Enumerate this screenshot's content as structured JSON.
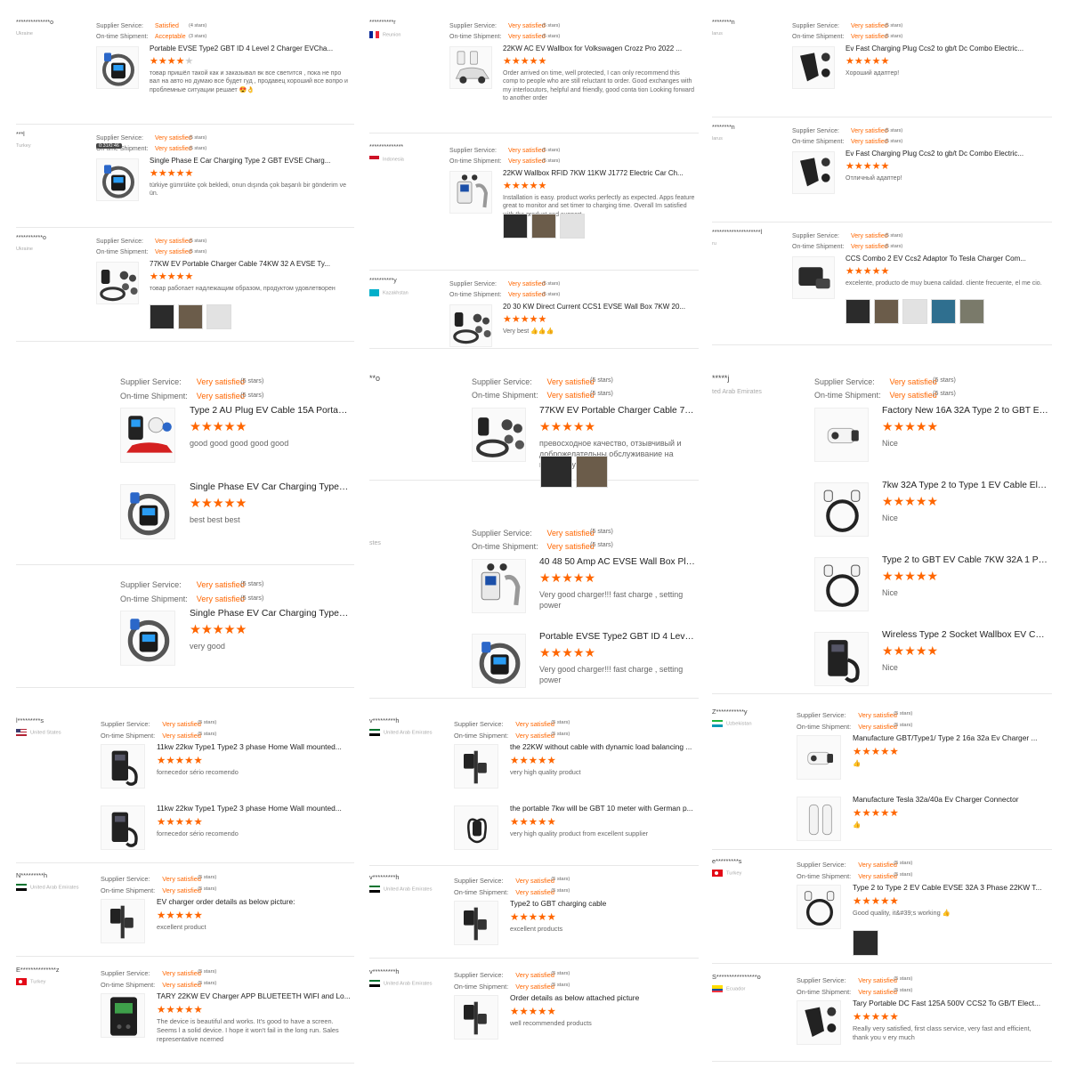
{
  "status_label": "Very satisfied",
  "stars_suffix": "(5 stars)",
  "supplier_label": "Supplier Service:",
  "shipment_label": "On-time Shipment:",
  "tiles": [
    {
      "id": "t1",
      "reviews": [
        {
          "user": "**************o",
          "country": "Ukraine",
          "flag": "none",
          "supplier_value": "Satisfied",
          "supplier_stars": "(4 stars)",
          "shipment_value": "Acceptable",
          "shipment_stars": "(3 stars)",
          "products": [
            {
              "title": "Portable EVSE Type2 GBT ID 4 Level 2 Charger EVCha...",
              "rating": 4,
              "img": "portable",
              "comment": "товар пришёл такой как и заказывал вк все светится , пока не про вал на авто но думаю все будет гуд , продавец хороший все вопро и проблемные ситуации решает 😍👌"
            }
          ],
          "thumbs": 0
        },
        {
          "user": "***l",
          "country": "Turkey",
          "flag": "none",
          "overlay_tag": "0:31/0:46",
          "supplier_value": "Very satisfied",
          "supplier_stars": "(5 stars)",
          "shipment_value": "Very satisfied",
          "shipment_stars": "(5 stars)",
          "products": [
            {
              "title": "Single Phase E Car Charging Type 2 GBT EVSE Charg...",
              "rating": 5,
              "img": "coil",
              "comment": "türkiye gümrükte çok bekledi, onun dışında çok başarılı bir gönderim ve ün."
            }
          ],
          "thumbs": 0
        },
        {
          "user": "***********o",
          "country": "Ukraine",
          "flag": "none",
          "supplier_value": "Very satisfied",
          "supplier_stars": "(5 stars)",
          "shipment_value": "Very satisfied",
          "shipment_stars": "(5 stars)",
          "products": [
            {
              "title": "77KW EV Portable Charger Cable 74KW 32 A EVSE Ty...",
              "rating": 5,
              "img": "kit",
              "comment": "товар работает надлежащим образом, продуктом удовлетворен"
            }
          ],
          "thumbs": 3
        }
      ]
    },
    {
      "id": "t2",
      "reviews": [
        {
          "user": "**********r",
          "country": "Reunion",
          "flag": "fr",
          "supplier_value": "Very satisfied",
          "supplier_stars": "(5 stars)",
          "shipment_value": "Very satisfied",
          "shipment_stars": "(5 stars)",
          "products": [
            {
              "title": "22KW AC EV Wallbox for Volkswagen Crozz Pro 2022 ...",
              "rating": 5,
              "img": "car",
              "comment": "Order arrived on time, well protected, I can only recommend this comp to people who are still reluctant to order. Good exchanges with my interlocutors, helpful and friendly, good conta tion Looking forward to another order"
            }
          ],
          "thumbs": 0
        },
        {
          "user": "**************",
          "country": "Indonesia",
          "flag": "id",
          "supplier_value": "Very satisfied",
          "supplier_stars": "(5 stars)",
          "shipment_value": "Very satisfied",
          "shipment_stars": "(5 stars)",
          "products": [
            {
              "title": "22KW Wallbox RFID 7KW 11KW J1772 Electric Car Ch...",
              "rating": 5,
              "img": "wallbox",
              "comment": "Installation is easy. product works perfectly as expected. Apps feature great to monitor and set timer to charging time. Overall Im satisfied with the product and support"
            }
          ],
          "thumbs": 3
        },
        {
          "user": "**********y",
          "country": "Kazakhstan",
          "flag": "kz",
          "supplier_value": "Very satisfied",
          "supplier_stars": "(5 stars)",
          "shipment_value": "Very satisfied",
          "shipment_stars": "(5 stars)",
          "products": [
            {
              "title": "20 30 KW Direct Current CCS1 EVSE Wall Box 7KW 20...",
              "rating": 5,
              "img": "kit",
              "comment": "Very best 👍👍👍"
            }
          ],
          "thumbs": 0
        }
      ]
    },
    {
      "id": "t3",
      "reviews": [
        {
          "user": "********n",
          "country": "larus",
          "flag": "none",
          "supplier_value": "Very satisfied",
          "supplier_stars": "(5 stars)",
          "shipment_value": "Very satisfied",
          "shipment_stars": "(5 stars)",
          "products": [
            {
              "title": "Ev Fast Charging Plug Ccs2 to gb/t Dc Combo Electric...",
              "rating": 5,
              "img": "plug",
              "comment": "Хороший адаптер!"
            }
          ],
          "thumbs": 0
        },
        {
          "user": "********n",
          "country": "larus",
          "flag": "none",
          "supplier_value": "Very satisfied",
          "supplier_stars": "(5 stars)",
          "shipment_value": "Very satisfied",
          "shipment_stars": "(5 stars)",
          "products": [
            {
              "title": "Ev Fast Charging Plug Ccs2 to gb/t Dc Combo Electric...",
              "rating": 5,
              "img": "plug",
              "comment": "Отличный адаптер!"
            }
          ],
          "thumbs": 0
        },
        {
          "user": "********************l",
          "country": "ru",
          "flag": "none",
          "supplier_value": "Very satisfied",
          "supplier_stars": "(5 stars)",
          "shipment_value": "Very satisfied",
          "shipment_stars": "(5 stars)",
          "products": [
            {
              "title": "CCS Combo 2 EV Ccs2 Adaptor To Tesla Charger Com...",
              "rating": 5,
              "img": "case",
              "comment": "excelente, producto de muy buena calidad. cliente frecuente, el me cio."
            }
          ],
          "thumbs": 5
        }
      ]
    },
    {
      "id": "t4",
      "reviews": [
        {
          "user": "",
          "country": "",
          "flag": "none",
          "supplier_value": "Very satisfied",
          "supplier_stars": "(5 stars)",
          "shipment_value": "Very satisfied",
          "shipment_stars": "(5 stars)",
          "products": [
            {
              "title": "Type 2 AU Plug EV Cable 15A Portable EVSE Typ GBT ...",
              "rating": 5,
              "img": "redcar",
              "comment": "good good good good good"
            },
            {
              "title": "Single Phase EV Car Charging Type 2 GBT EVSE Ac C...",
              "rating": 5,
              "img": "coil",
              "comment": "best best best"
            }
          ],
          "thumbs": 0
        },
        {
          "user": "",
          "country": "",
          "flag": "none",
          "supplier_value": "Very satisfied",
          "supplier_stars": "(5 stars)",
          "shipment_value": "Very satisfied",
          "shipment_stars": "(5 stars)",
          "products": [
            {
              "title": "Single Phase EV Car Charging Type 2 GBT EVSE Ac C...",
              "rating": 5,
              "img": "coil",
              "comment": "very good"
            }
          ],
          "thumbs": 0
        }
      ]
    },
    {
      "id": "t5",
      "reviews": [
        {
          "user": "**o",
          "country": "",
          "flag": "none",
          "supplier_value": "Very satisfied",
          "supplier_stars": "(5 stars)",
          "shipment_value": "Very satisfied",
          "shipment_stars": "(5 stars)",
          "products": [
            {
              "title": "77KW EV Portable Charger Cable 74KW 32 A EVSE Ty...",
              "rating": 5,
              "img": "kit",
              "comment": "превосходное качество, отзывчивый и доброжелательны обслуживание на высшем уровне"
            }
          ],
          "thumbs": 2
        },
        {
          "user": "",
          "country": "stes",
          "flag": "none",
          "supplier_value": "Very satisfied",
          "supplier_stars": "(5 stars)",
          "shipment_value": "Very satisfied",
          "shipment_stars": "(5 stars)",
          "products": [
            {
              "title": "40 48 50 Amp AC EVSE Wall Box Plugin 32A EV Charg...",
              "rating": 5,
              "img": "wallbox",
              "comment": "Very good charger!!! fast charge , setting power"
            },
            {
              "title": "Portable EVSE Type2 GBT ID 4 Level 2 Charger EVCha...",
              "rating": 5,
              "img": "portable",
              "comment": "Very good charger!!! fast charge , setting power"
            }
          ],
          "thumbs": 0
        }
      ]
    },
    {
      "id": "t6",
      "reviews": [
        {
          "user": "*****j",
          "country": "ted Arab Emirates",
          "flag": "none",
          "supplier_value": "Very satisfied",
          "supplier_stars": "(5 stars)",
          "shipment_value": "Very satisfied",
          "shipment_stars": "(5 stars)",
          "products": [
            {
              "title": "Factory New 16A 32A Type 2 to GBT EV Adapter with ...",
              "rating": 5,
              "img": "adapter",
              "comment": "Nice"
            },
            {
              "title": "7kw 32A Type 2 to Type 1 EV Cable Electric Vehicle E...",
              "rating": 5,
              "img": "cable",
              "comment": "Nice"
            },
            {
              "title": "Type 2 to GBT EV Cable 7KW 32A 1 Phase Electric Ve...",
              "rating": 5,
              "img": "cable",
              "comment": "Nice"
            },
            {
              "title": "Wireless Type 2 Socket Wallbox EV Charger Station 7...",
              "rating": 5,
              "img": "wallbox2",
              "comment": "Nice"
            }
          ],
          "thumbs": 0
        }
      ]
    },
    {
      "id": "t7",
      "reviews": [
        {
          "user": "l*********s",
          "country": "United States",
          "flag": "us",
          "supplier_value": "Very satisfied",
          "supplier_stars": "(5 stars)",
          "shipment_value": "Very satisfied",
          "shipment_stars": "(5 stars)",
          "products": [
            {
              "title": "11kw 22kw Type1 Type2 3 phase Home Wall mounted...",
              "rating": 5,
              "img": "wallbox2",
              "comment": "fornecedor sério recomendo"
            },
            {
              "title": "11kw 22kw Type1 Type2 3 phase Home Wall mounted...",
              "rating": 5,
              "img": "wallbox2",
              "comment": "fornecedor sério recomendo"
            }
          ],
          "thumbs": 0
        },
        {
          "user": "N*********h",
          "country": "United Arab Emirates",
          "flag": "ae",
          "supplier_value": "Very satisfied",
          "supplier_stars": "(5 stars)",
          "shipment_value": "Very satisfied",
          "shipment_stars": "(5 stars)",
          "products": [
            {
              "title": "EV charger order details as below picture:",
              "rating": 5,
              "img": "post",
              "comment": "excellent product"
            }
          ],
          "thumbs": 0
        },
        {
          "user": "E**************z",
          "country": "Turkey",
          "flag": "tr",
          "supplier_value": "Very satisfied",
          "supplier_stars": "(5 stars)",
          "shipment_value": "Very satisfied",
          "shipment_stars": "(5 stars)",
          "products": [
            {
              "title": "TARY 22KW EV Charger APP BLUETEETH WIFI and Lo...",
              "rating": 5,
              "img": "screenbox",
              "comment": "The device is beautiful and works. It's good to have a screen. Seems l a solid device. I hope it won't fail in the long run. Sales representative ncerned"
            }
          ],
          "thumbs": 0
        }
      ]
    },
    {
      "id": "t8",
      "reviews": [
        {
          "user": "v*********h",
          "country": "United Arab Emirates",
          "flag": "ae",
          "supplier_value": "Very satisfied",
          "supplier_stars": "(5 stars)",
          "shipment_value": "Very satisfied",
          "shipment_stars": "(5 stars)",
          "products": [
            {
              "title": "the 22KW without cable with dynamic load balancing ...",
              "rating": 5,
              "img": "post",
              "comment": "very high quality product"
            },
            {
              "title": "the portable 7kw will be GBT 10 meter with German p...",
              "rating": 5,
              "img": "portable2",
              "comment": "very high quality product from excellent supplier"
            }
          ],
          "thumbs": 0
        },
        {
          "user": "v*********h",
          "country": "United Arab Emirates",
          "flag": "ae",
          "supplier_value": "Very satisfied",
          "supplier_stars": "(5 stars)",
          "shipment_value": "Very satisfied",
          "shipment_stars": "(5 stars)",
          "products": [
            {
              "title": "Type2 to GBT charging cable",
              "rating": 5,
              "img": "post",
              "comment": "excellent products"
            }
          ],
          "thumbs": 0
        },
        {
          "user": "v*********h",
          "country": "United Arab Emirates",
          "flag": "ae",
          "supplier_value": "Very satisfied",
          "supplier_stars": "(5 stars)",
          "shipment_value": "Very satisfied",
          "shipment_stars": "(5 stars)",
          "products": [
            {
              "title": "Order details as below attached picture",
              "rating": 5,
              "img": "post",
              "comment": "well recommended products"
            }
          ],
          "thumbs": 0
        }
      ]
    },
    {
      "id": "t9",
      "reviews": [
        {
          "user": "Z***********y",
          "country": "Uzbekistan",
          "flag": "uz",
          "supplier_value": "Very satisfied",
          "supplier_stars": "(5 stars)",
          "shipment_value": "Very satisfied",
          "shipment_stars": "(5 stars)",
          "products": [
            {
              "title": "Manufacture GBT/Type1/ Type 2 16a 32a Ev Charger ...",
              "rating": 5,
              "img": "adapter",
              "comment": "👍"
            },
            {
              "title": "Manufacture Tesla 32a/40a Ev Charger Connector",
              "rating": 5,
              "img": "connector",
              "comment": "👍"
            }
          ],
          "thumbs": 0
        },
        {
          "user": "e*********s",
          "country": "Turkey",
          "flag": "tr",
          "supplier_value": "Very satisfied",
          "supplier_stars": "(5 stars)",
          "shipment_value": "Very satisfied",
          "shipment_stars": "(5 stars)",
          "products": [
            {
              "title": "Type 2 to Type 2 EV Cable EVSE 32A 3 Phase 22KW T...",
              "rating": 5,
              "img": "cable",
              "comment": "Good quality, it&#39;s working 👍"
            }
          ],
          "thumbs": 1
        },
        {
          "user": "S****************o",
          "country": "Ecuador",
          "flag": "ec",
          "supplier_value": "Very satisfied",
          "supplier_stars": "(5 stars)",
          "shipment_value": "Very satisfied",
          "shipment_stars": "(5 stars)",
          "products": [
            {
              "title": "Tary Portable DC Fast 125A 500V CCS2 To GB/T Elect...",
              "rating": 5,
              "img": "plug",
              "comment": "Really very satisfied, first class service, very fast and efficient, thank you v ery much"
            }
          ],
          "thumbs": 0
        }
      ]
    }
  ]
}
